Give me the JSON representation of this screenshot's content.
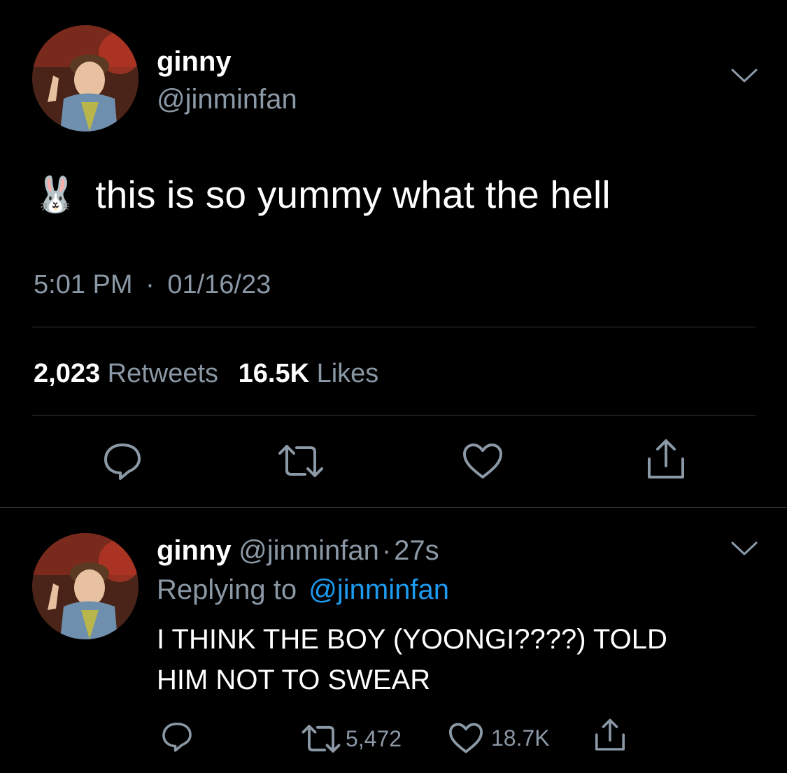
{
  "tweet": {
    "author_name": "ginny",
    "author_handle": "@jinminfan",
    "emoji": "🐰",
    "text": "this is so yummy what the hell",
    "time": "5:01 PM",
    "separator": "·",
    "date": "01/16/23",
    "retweets_count": "2,023",
    "retweets_label": "Retweets",
    "likes_count": "16.5K",
    "likes_label": "Likes",
    "icons": [
      "reply-icon",
      "retweet-icon",
      "like-icon",
      "share-icon"
    ]
  },
  "reply": {
    "author_name": "ginny",
    "author_handle": "@jinminfan",
    "separator": "·",
    "time_ago": "27s",
    "replying_to_label": "Replying to",
    "replying_to_handle": "@jinminfan",
    "text_line1": "I THINK THE BOY (YOONGI????) TOLD",
    "text_line2": "HIM NOT TO SWEAR",
    "retweet_count": "5,472",
    "like_count": "18.7K"
  },
  "colors": {
    "background": "#000000",
    "text_primary": "#ffffff",
    "text_secondary": "#8b98a5",
    "link": "#1d9bf0",
    "divider": "#2f3336"
  }
}
